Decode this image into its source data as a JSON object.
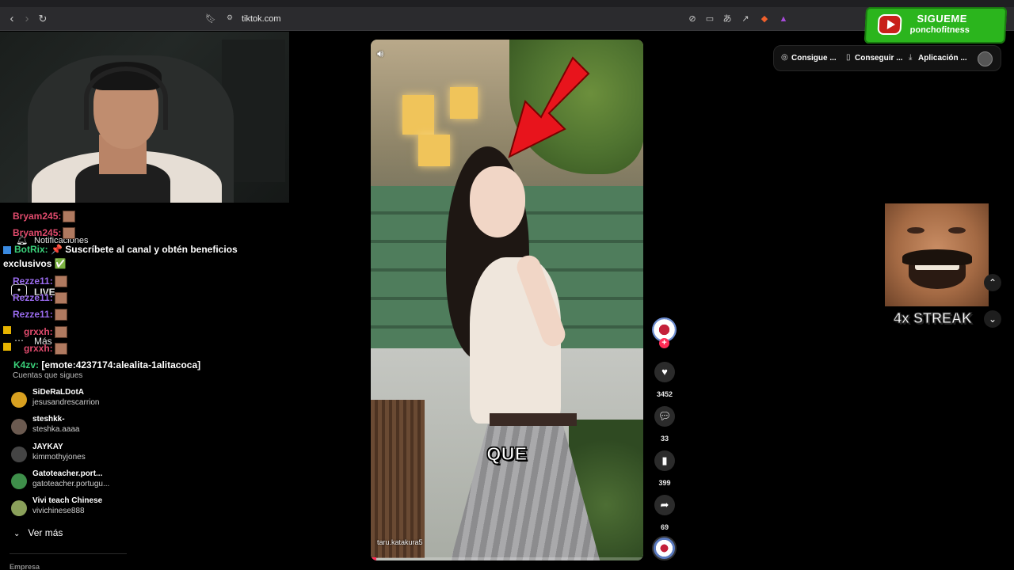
{
  "browser": {
    "url": "tiktok.com",
    "back_icon": "chevron-left-icon",
    "forward_icon": "chevron-right-icon",
    "reload_icon": "reload-icon"
  },
  "subscribe_banner": {
    "title": "SIGUEME",
    "handle": "ponchofitness",
    "colors": {
      "background": "#2bb51d",
      "play": "#c8201a"
    }
  },
  "chat": {
    "lines": [
      {
        "user": "Bryam245:",
        "text": "",
        "color": "#e14b6d"
      },
      {
        "user": "Bryam245:",
        "text": "",
        "color": "#e14b6d"
      },
      {
        "user": "BotRix:",
        "text": "📌 Suscríbete al canal y obtén beneficios",
        "color": "#3ad17a"
      },
      {
        "user": "",
        "text": "exclusivos ✅",
        "color": "#ffffff"
      },
      {
        "user": "Rezze11:",
        "text": "",
        "color": "#9b6cf0"
      },
      {
        "user": "Rezze11:",
        "text": "",
        "color": "#9b6cf0"
      },
      {
        "user": "Rezze11:",
        "text": "",
        "color": "#9b6cf0"
      },
      {
        "user": "grxxh:",
        "text": "",
        "color": "#e14b6d"
      },
      {
        "user": "grxxh:",
        "text": "",
        "color": "#e14b6d"
      },
      {
        "user": "K4zv:",
        "text": "[emote:4237174:alealita-1alitacoca]",
        "color": "#3ad17a"
      }
    ]
  },
  "sidebar": {
    "items": [
      {
        "label": "Notificaciones"
      },
      {
        "label": "LIVE"
      },
      {
        "label": "Más"
      }
    ],
    "following_title": "Cuentas que sigues",
    "accounts": [
      {
        "name": "SiDeRaLDotA",
        "user": "jesusandrescarrion",
        "color": "#d8a020"
      },
      {
        "name": "steshkk-",
        "user": "steshka.aaaa",
        "color": "#6b5a50"
      },
      {
        "name": "JAYKAY",
        "user": "kimmothyjones",
        "color": "#444444"
      },
      {
        "name": "Gatoteacher.port...",
        "user": "gatoteacher.portugu...",
        "color": "#3e8f4a"
      },
      {
        "name": "Vivi teach Chinese",
        "user": "vivichinese888",
        "color": "#8aa05a"
      }
    ],
    "see_more": "Ver más",
    "company": "Empresa"
  },
  "video": {
    "caption": "QUE",
    "author": "taru.katakura5",
    "progress": 0.02,
    "volume_icon": "speaker-icon"
  },
  "actions": {
    "likes": "3452",
    "comments": "33",
    "saves": "399",
    "shares": "69"
  },
  "top_bar": {
    "pills": [
      {
        "label": "Consigue ...",
        "icon": "coin-icon"
      },
      {
        "label": "Conseguir ...",
        "icon": "phone-icon"
      },
      {
        "label": "Aplicación ...",
        "icon": "download-icon"
      }
    ]
  },
  "streak": {
    "text": "4x STREAK"
  }
}
